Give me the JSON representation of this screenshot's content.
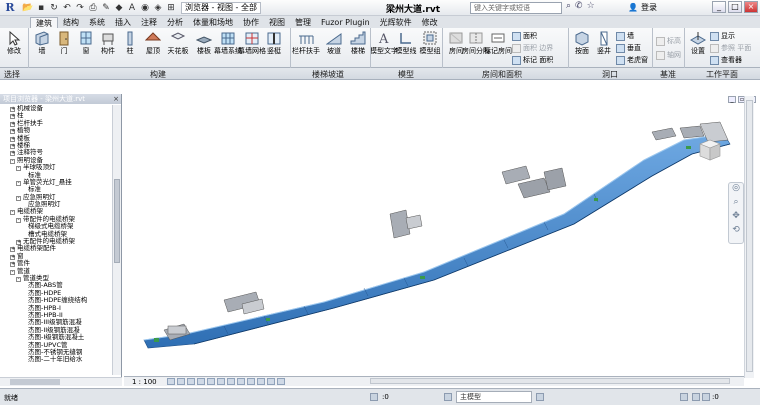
{
  "titlebar": {
    "app_logo": "R",
    "view_combo": "浏览器 - 视图 - 全部",
    "title": "梁州大道.rvt",
    "search_placeholder": "键入关键字或短语",
    "login": "登录",
    "win_min": "_",
    "win_max": "□",
    "win_close": "×"
  },
  "tabs": [
    "建筑",
    "结构",
    "系统",
    "插入",
    "注释",
    "分析",
    "体量和场地",
    "协作",
    "视图",
    "管理",
    "Fuzor Plugin",
    "光辉软件",
    "修改"
  ],
  "active_tab": "建筑",
  "ribbon": {
    "buttons": [
      {
        "label": "修改"
      },
      {
        "label": "墙"
      },
      {
        "label": "门"
      },
      {
        "label": "窗"
      },
      {
        "label": "构件"
      },
      {
        "label": "柱"
      },
      {
        "label": "屋顶"
      },
      {
        "label": "天花板"
      },
      {
        "label": "楼板"
      },
      {
        "label": "幕墙系统"
      },
      {
        "label": "幕墙网格"
      },
      {
        "label": "竖梃"
      },
      {
        "label": "栏杆扶手"
      },
      {
        "label": "坡道"
      },
      {
        "label": "楼梯"
      },
      {
        "label": "模型文字"
      },
      {
        "label": "模型线"
      },
      {
        "label": "模型组"
      },
      {
        "label": "房间"
      },
      {
        "label": "房间分隔"
      },
      {
        "label": "标记房间"
      },
      {
        "label": "按面"
      },
      {
        "label": "竖井"
      },
      {
        "label": "设置"
      }
    ],
    "small_items": {
      "area": "面积",
      "area_boundary": "面积 边界",
      "tag_area": "标记 面积",
      "wall": "墙",
      "vertical": "垂直",
      "dormer": "老虎窗",
      "level": "标高",
      "grid": "轴网",
      "show": "显示",
      "ref_plane": "参照 平面",
      "viewer": "查看器"
    },
    "panels": [
      "选择",
      "构建",
      "楼梯坡道",
      "模型",
      "房间和面积",
      "洞口",
      "基准",
      "工作平面"
    ]
  },
  "browser": {
    "title": "项目浏览器 - 梁州大道.rvt",
    "close": "×",
    "nodes": [
      {
        "indent": 1,
        "box": "+",
        "label": "机械设备"
      },
      {
        "indent": 1,
        "box": "+",
        "label": "柱"
      },
      {
        "indent": 1,
        "box": "+",
        "label": "栏杆扶手"
      },
      {
        "indent": 1,
        "box": "+",
        "label": "植物"
      },
      {
        "indent": 1,
        "box": "+",
        "label": "楼板"
      },
      {
        "indent": 1,
        "box": "+",
        "label": "楼梯"
      },
      {
        "indent": 1,
        "box": "+",
        "label": "注释符号"
      },
      {
        "indent": 1,
        "box": "-",
        "label": "照明设备"
      },
      {
        "indent": 2,
        "box": "-",
        "label": "半球吸顶灯"
      },
      {
        "indent": 4,
        "box": "",
        "label": "标准"
      },
      {
        "indent": 2,
        "box": "-",
        "label": "单管荧光灯_悬挂"
      },
      {
        "indent": 4,
        "box": "",
        "label": "标准"
      },
      {
        "indent": 2,
        "box": "-",
        "label": "应急照明灯"
      },
      {
        "indent": 4,
        "box": "",
        "label": "应急照明灯"
      },
      {
        "indent": 1,
        "box": "-",
        "label": "电缆桥架"
      },
      {
        "indent": 2,
        "box": "-",
        "label": "带配件的电缆桥架"
      },
      {
        "indent": 4,
        "box": "",
        "label": "梯级式电缆桥架"
      },
      {
        "indent": 4,
        "box": "",
        "label": "槽式电缆桥架"
      },
      {
        "indent": 2,
        "box": "+",
        "label": "无配件的电缆桥架"
      },
      {
        "indent": 1,
        "box": "+",
        "label": "电缆桥架配件"
      },
      {
        "indent": 1,
        "box": "+",
        "label": "窗"
      },
      {
        "indent": 1,
        "box": "+",
        "label": "管件"
      },
      {
        "indent": 1,
        "box": "-",
        "label": "管道"
      },
      {
        "indent": 2,
        "box": "-",
        "label": "管道类型"
      },
      {
        "indent": 4,
        "box": "",
        "label": "杰图-ABS管"
      },
      {
        "indent": 4,
        "box": "",
        "label": "杰图-HDPE"
      },
      {
        "indent": 4,
        "box": "",
        "label": "杰图-HDPE缠绕结构"
      },
      {
        "indent": 4,
        "box": "",
        "label": "杰图-HPB-I"
      },
      {
        "indent": 4,
        "box": "",
        "label": "杰图-HPB-II"
      },
      {
        "indent": 4,
        "box": "",
        "label": "杰图-III级钢筋混凝"
      },
      {
        "indent": 4,
        "box": "",
        "label": "杰图-II级钢筋混凝"
      },
      {
        "indent": 4,
        "box": "",
        "label": "杰图-I级钢筋混凝土"
      },
      {
        "indent": 4,
        "box": "",
        "label": "杰图-UPVC管"
      },
      {
        "indent": 4,
        "box": "",
        "label": "杰图-不锈钢无缝钢"
      },
      {
        "indent": 4,
        "box": "",
        "label": "杰图-二十年旧给水"
      }
    ]
  },
  "viewbar": {
    "scale": "1 : 100"
  },
  "status": {
    "ready": "就绪",
    "coord1": ":0",
    "model": "主模型",
    "coord2": ":0"
  },
  "colors": {
    "tunnel_top": "#4a8fd4",
    "tunnel_side": "#2f6fb4",
    "ribbon_bg": "#eef1f4",
    "structure_gray": "#9aa0a8"
  }
}
